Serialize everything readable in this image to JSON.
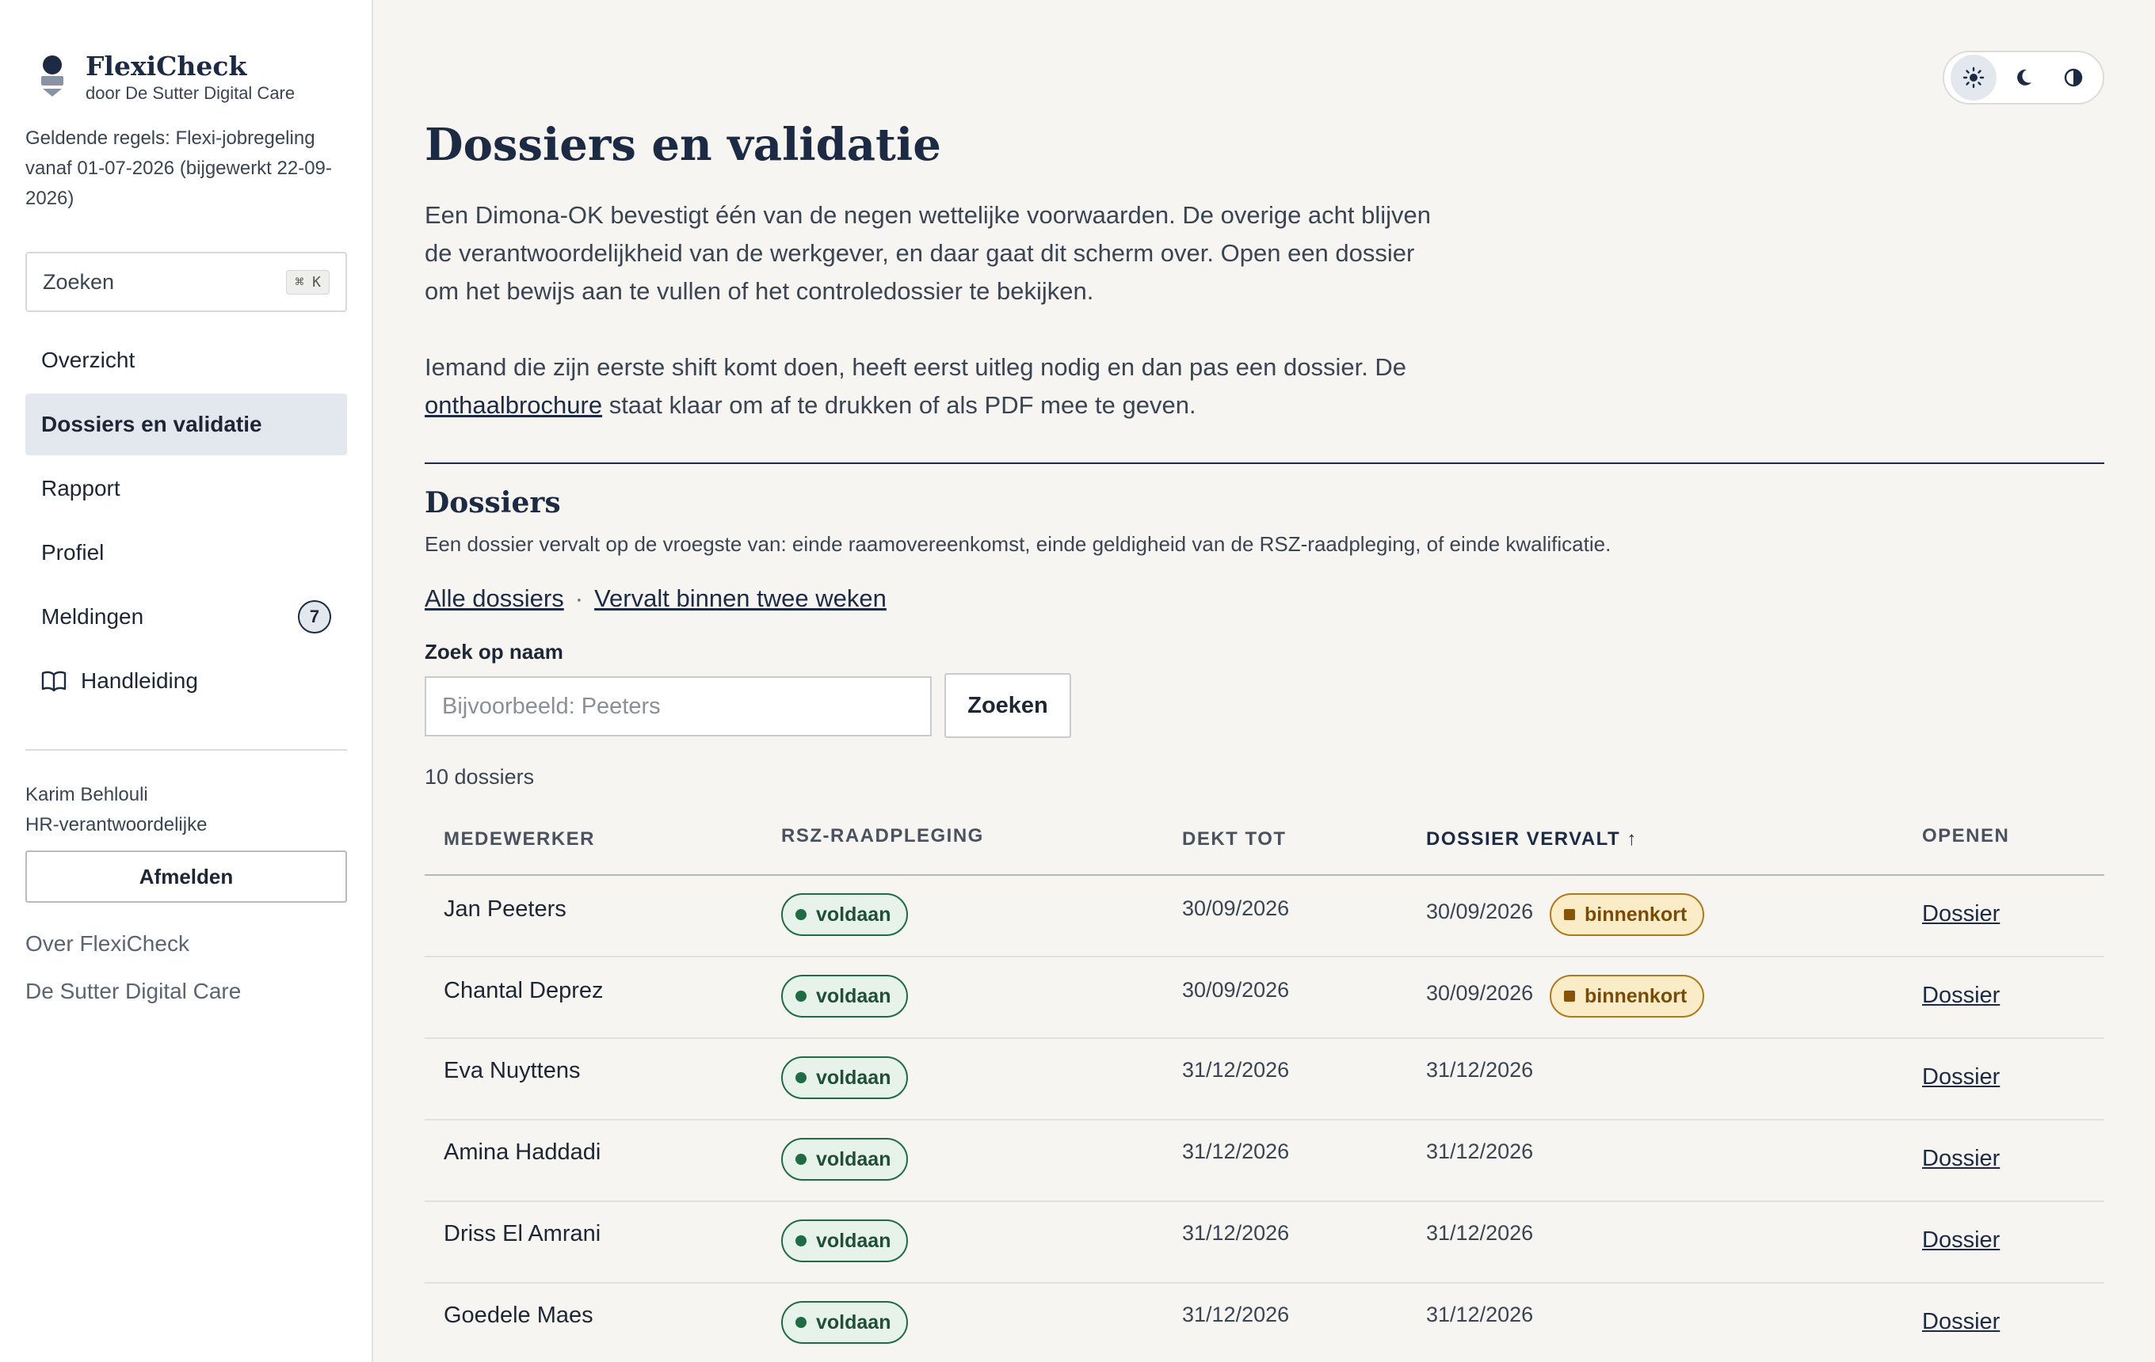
{
  "brand": {
    "name": "FlexiCheck",
    "sub": "door De Sutter Digital Care"
  },
  "rules_text": "Geldende regels: Flexi-jobregeling vanaf 01-07-2026 (bijgewerkt 22-09-2026)",
  "search": {
    "label": "Zoeken",
    "shortcut": "⌘ K"
  },
  "nav": [
    {
      "label": "Overzicht",
      "active": false
    },
    {
      "label": "Dossiers en validatie",
      "active": true
    },
    {
      "label": "Rapport",
      "active": false
    },
    {
      "label": "Profiel",
      "active": false
    },
    {
      "label": "Meldingen",
      "active": false,
      "count": "7"
    },
    {
      "label": "Handleiding",
      "active": false,
      "icon": "book-icon"
    }
  ],
  "user": {
    "name": "Karim Behlouli",
    "role": "HR-verantwoordelijke",
    "logout": "Afmelden"
  },
  "footer_links": [
    "Over FlexiCheck",
    "De Sutter Digital Care"
  ],
  "theme": {
    "icons": [
      "sun-icon",
      "moon-icon",
      "contrast-icon"
    ],
    "active": "sun-icon"
  },
  "page": {
    "title": "Dossiers en validatie",
    "intro": "Een Dimona-OK bevestigt één van de negen wettelijke voorwaarden. De overige acht blijven de verantwoordelijkheid van de werkgever, en daar gaat dit scherm over. Open een dossier om het bewijs aan te vullen of het controledossier te bekijken.",
    "intro2_before": "Iemand die zijn eerste shift komt doen, heeft eerst uitleg nodig en dan pas een dossier. De",
    "intro2_link": "onthaalbrochure",
    "intro2_after": "staat klaar om af te drukken of als PDF mee te geven."
  },
  "dossiers": {
    "title": "Dossiers",
    "subtitle": "Een dossier vervalt op de vroegste van: einde raamovereenkomst, einde geldigheid van de RSZ-raadpleging, of einde kwalificatie.",
    "filter_all": "Alle dossiers",
    "filter_separator": "·",
    "filter_soon": "Vervalt binnen twee weken",
    "search_label": "Zoek op naam",
    "search_placeholder": "Bijvoorbeeld: Peeters",
    "search_button": "Zoeken",
    "count_text": "10 dossiers",
    "columns": {
      "employee": "Medewerker",
      "rsz": "RSZ-raadpleging",
      "covers": "Dekt tot",
      "expires": "Dossier vervalt",
      "sort_arrow": "↑",
      "open": "Openen"
    },
    "rows": [
      {
        "name": "Jan Peeters",
        "rsz": "voldaan",
        "covers": "30/09/2026",
        "expires": "30/09/2026",
        "flag": "binnenkort",
        "open": "Dossier"
      },
      {
        "name": "Chantal Deprez",
        "rsz": "voldaan",
        "covers": "30/09/2026",
        "expires": "30/09/2026",
        "flag": "binnenkort",
        "open": "Dossier"
      },
      {
        "name": "Eva Nuyttens",
        "rsz": "voldaan",
        "covers": "31/12/2026",
        "expires": "31/12/2026",
        "flag": "",
        "open": "Dossier"
      },
      {
        "name": "Amina Haddadi",
        "rsz": "voldaan",
        "covers": "31/12/2026",
        "expires": "31/12/2026",
        "flag": "",
        "open": "Dossier"
      },
      {
        "name": "Driss El Amrani",
        "rsz": "voldaan",
        "covers": "31/12/2026",
        "expires": "31/12/2026",
        "flag": "",
        "open": "Dossier"
      },
      {
        "name": "Goedele Maes",
        "rsz": "voldaan",
        "covers": "31/12/2026",
        "expires": "31/12/2026",
        "flag": "",
        "open": "Dossier"
      }
    ]
  },
  "colors": {
    "navy": "#1c2a44",
    "ok_green": "#1f6b43",
    "warn_amber": "#b07a1c"
  }
}
